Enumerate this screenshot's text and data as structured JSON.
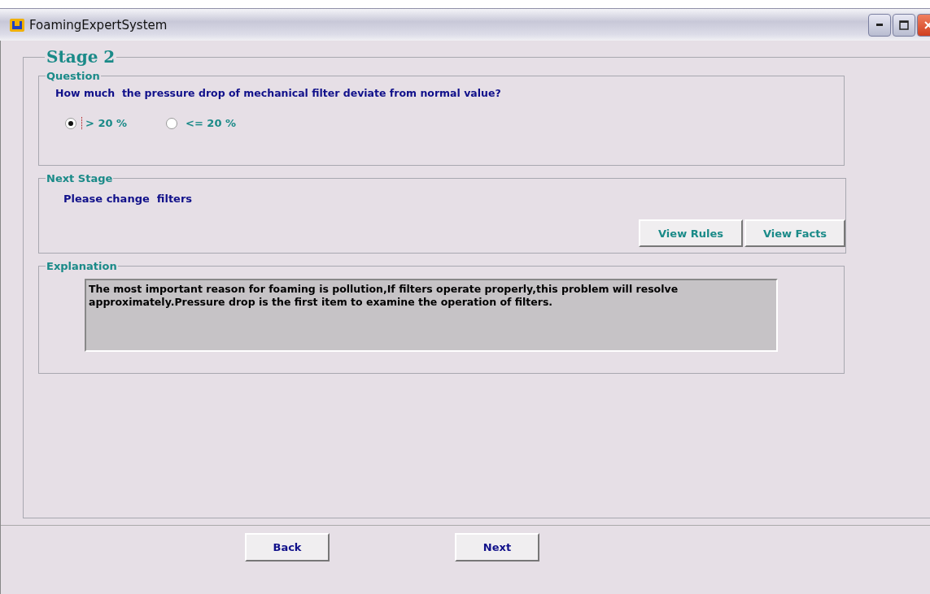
{
  "window": {
    "title": "FoamingExpertSystem"
  },
  "stage": {
    "title": "Stage 2"
  },
  "question": {
    "legend": "Question",
    "text": "How much  the pressure drop of mechanical filter deviate from normal value?",
    "options": [
      {
        "label": "> 20 %",
        "selected": true
      },
      {
        "label": "<= 20 %",
        "selected": false
      }
    ]
  },
  "next_stage": {
    "legend": "Next Stage",
    "text": "Please change  filters",
    "buttons": [
      "View Rules",
      "View Facts"
    ]
  },
  "explanation": {
    "legend": "Explanation",
    "text": "The most important reason for foaming is pollution,If filters operate properly,this problem will resolve approximately.Pressure drop is the first item to examine the operation of filters."
  },
  "nav_buttons": [
    "Back",
    "Next"
  ]
}
